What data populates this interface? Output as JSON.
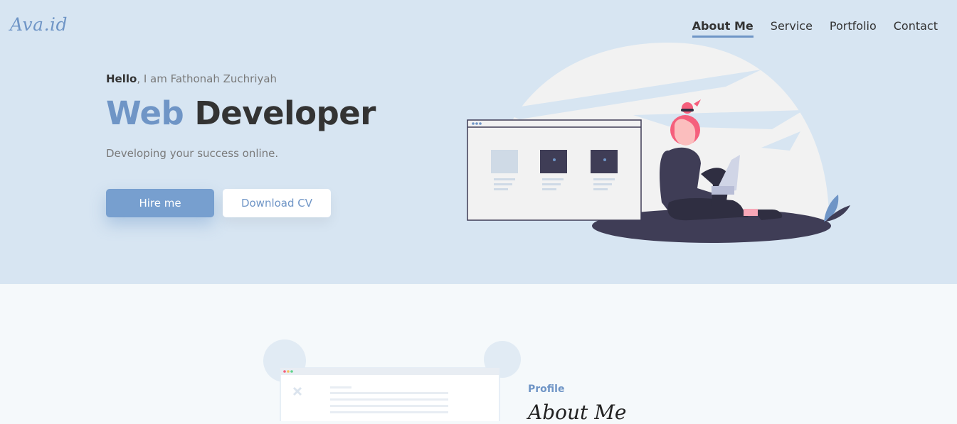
{
  "brand": {
    "logo": "Ava.id"
  },
  "nav": {
    "items": [
      {
        "label": "About Me",
        "active": true
      },
      {
        "label": "Service",
        "active": false
      },
      {
        "label": "Portfolio",
        "active": false
      },
      {
        "label": "Contact",
        "active": false
      }
    ]
  },
  "hero": {
    "greeting_bold": "Hello",
    "greeting_rest": ", I am Fathonah Zuchriyah",
    "title_accent": "Web",
    "title_main": "Developer",
    "tagline": "Developing your success online.",
    "primary_button": "Hire me",
    "secondary_button": "Download CV"
  },
  "about": {
    "label": "Profile",
    "title": "About Me"
  },
  "colors": {
    "accent": "#6f95c6",
    "hero_bg": "#d7e5f2",
    "figure_dark": "#3f3d56",
    "hair": "#f55f7c"
  }
}
